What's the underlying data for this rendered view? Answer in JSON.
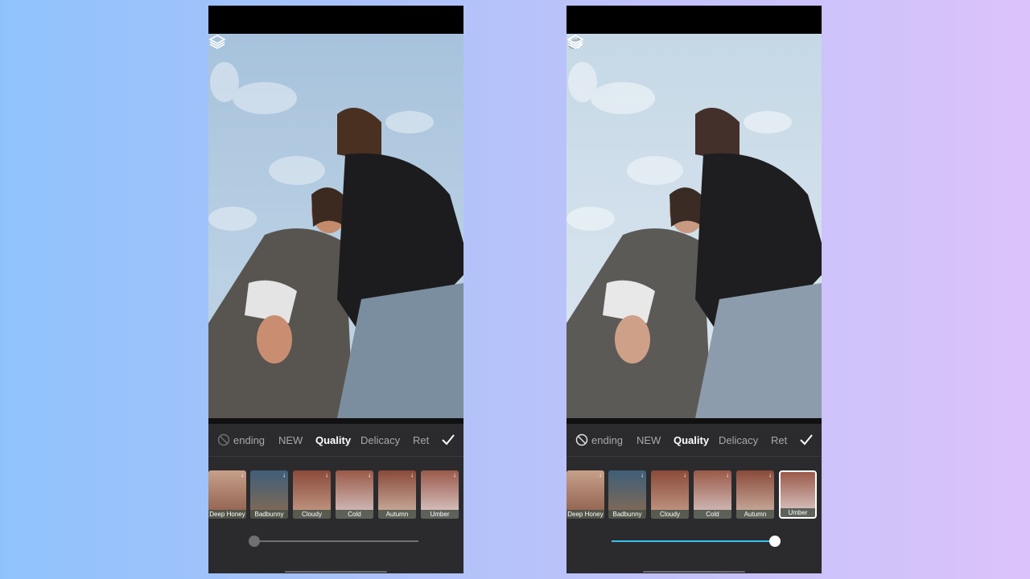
{
  "panels": [
    {
      "id": "before",
      "tabs": [
        "ending",
        "NEW",
        "Quality",
        "Delicacy",
        "Ret"
      ],
      "active_tab": "Quality",
      "filters": [
        "Deep Honey",
        "Badbunny",
        "Cloudy",
        "Cold",
        "Autumn",
        "Umber"
      ],
      "selected_filter": null,
      "intensity": 0.0
    },
    {
      "id": "after",
      "tabs": [
        "ending",
        "NEW",
        "Quality",
        "Delicacy",
        "Ret"
      ],
      "active_tab": "Quality",
      "filters": [
        "Deep Honey",
        "Badbunny",
        "Cloudy",
        "Cold",
        "Autumn",
        "Umber"
      ],
      "selected_filter": "Umber",
      "intensity": 1.0
    }
  ],
  "colors": {
    "slider_active": "#39c1ef",
    "panel_bg": "#2b2b2e",
    "tab_active": "#ffffff",
    "tab_inactive": "#a8a8ad"
  },
  "icons": [
    "no-filter-icon",
    "check-icon",
    "layers-icon",
    "undo-icon",
    "redo-icon",
    "download-icon"
  ]
}
